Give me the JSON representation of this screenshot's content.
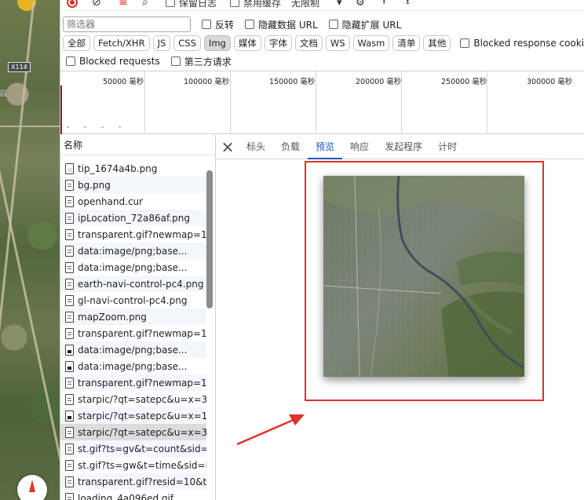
{
  "toolbar": {
    "preserve_log": "保留日志",
    "disable_cache": "禁用缓存",
    "throttle": "无限制"
  },
  "filter": {
    "placeholder": "筛选器",
    "invert": "反转",
    "hide_data_url": "隐藏数据 URL",
    "hide_ext_url": "隐藏扩展 URL"
  },
  "types": [
    "全部",
    "Fetch/XHR",
    "JS",
    "CSS",
    "Img",
    "媒体",
    "字体",
    "文档",
    "WS",
    "Wasm",
    "清单",
    "其他"
  ],
  "blocked_cookies": "Blocked response cookies",
  "blocked_requests": "Blocked requests",
  "third_party": "第三方请求",
  "timeline": {
    "labels": [
      "50000 毫秒",
      "100000 毫秒",
      "150000 毫秒",
      "200000 毫秒",
      "250000 毫秒",
      "300000 毫秒"
    ]
  },
  "list": {
    "header": "名称",
    "rows": [
      "tip_1674a4b.png",
      "bg.png",
      "openhand.cur",
      "ipLocation_72a86af.png",
      "transparent.gif?newmap=1...",
      "data:image/png;base...",
      "data:image/png;base...",
      "earth-navi-control-pc4.png",
      "gl-navi-control-pc4.png",
      "mapZoom.png",
      "transparent.gif?newmap=1...",
      "data:image/png;base...",
      "data:image/png;base...",
      "transparent.gif?newmap=1...",
      "starpic/?qt=satepc&u=x=3...",
      "starpic/?qt=satepc&u=x=1;...",
      "starpic/?qt=satepc&u=x=3...",
      "st.gif?ts=gv&t=count&sid=...",
      "st.gif?ts=gw&t=time&sid=l...",
      "transparent.gif?resid=10&t...",
      "loading_4a096ed.gif"
    ]
  },
  "detail": {
    "tabs": [
      "标头",
      "负载",
      "预览",
      "响应",
      "发起程序",
      "计时"
    ],
    "active_tab": "预览"
  },
  "map": {
    "road_label": "X114",
    "place_label": "园"
  },
  "colors": {
    "highlight_red": "#e0302b",
    "active_tab_blue": "#1a56c4"
  }
}
